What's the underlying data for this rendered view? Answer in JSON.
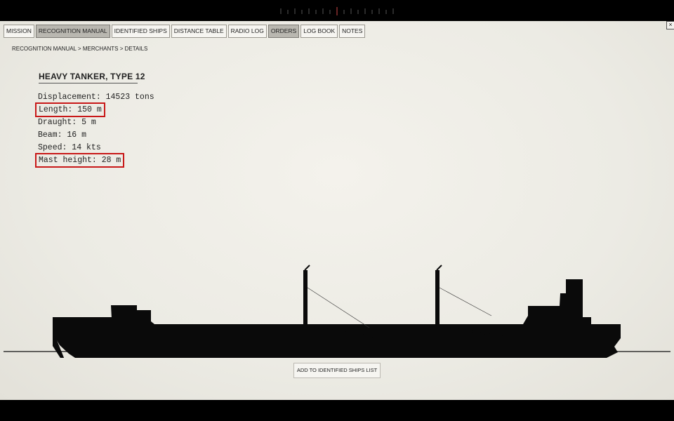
{
  "tabs": [
    {
      "label": "Mission",
      "active": false
    },
    {
      "label": "Recognition Manual",
      "active": true
    },
    {
      "label": "Identified Ships",
      "active": false
    },
    {
      "label": "Distance Table",
      "active": false
    },
    {
      "label": "Radio Log",
      "active": false
    },
    {
      "label": "Orders",
      "active": true
    },
    {
      "label": "Log Book",
      "active": false
    },
    {
      "label": "Notes",
      "active": false
    }
  ],
  "close_label": "×",
  "breadcrumb": "RECOGNITION MANUAL > MERCHANTS > DETAILS",
  "ship": {
    "title": "HEAVY TANKER, TYPE 12",
    "specs": [
      {
        "text": "Displacement: 14523 tons",
        "highlighted": false
      },
      {
        "text": "Length: 150 m",
        "highlighted": true
      },
      {
        "text": "Draught: 5 m",
        "highlighted": false
      },
      {
        "text": "Beam: 16 m",
        "highlighted": false
      },
      {
        "text": "Speed: 14 kts",
        "highlighted": false
      },
      {
        "text": "Mast height: 28 m",
        "highlighted": true
      }
    ]
  },
  "add_button": "ADD TO IDENTIFIED SHIPS LIST",
  "colors": {
    "highlight": "#c81818",
    "active_tab": "#b9b7b0"
  }
}
